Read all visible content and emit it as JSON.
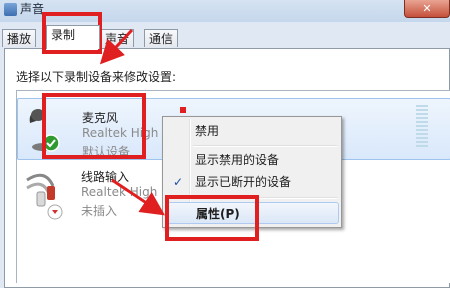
{
  "window": {
    "title": "声音",
    "close_label": "✕"
  },
  "tabs": [
    {
      "label": "播放"
    },
    {
      "label": "录制"
    },
    {
      "label": "声音"
    },
    {
      "label": "通信"
    }
  ],
  "instruction": "选择以下录制设备来修改设置:",
  "devices": [
    {
      "name": "麦克风",
      "driver": "Realtek High",
      "status": "默认设备",
      "icon": "microphone-icon"
    },
    {
      "name": "线路输入",
      "driver": "Realtek High",
      "status": "未插入",
      "icon": "line-in-cable-icon"
    }
  ],
  "context_menu": {
    "items": [
      {
        "label": "禁用"
      },
      {
        "label": "显示禁用的设备"
      },
      {
        "label": "显示已断开的设备",
        "checked": "✓"
      },
      {
        "label": "属性(P)"
      }
    ]
  },
  "colors": {
    "annotation_red": "#e02020",
    "selection_blue": "#d9e8fb"
  }
}
